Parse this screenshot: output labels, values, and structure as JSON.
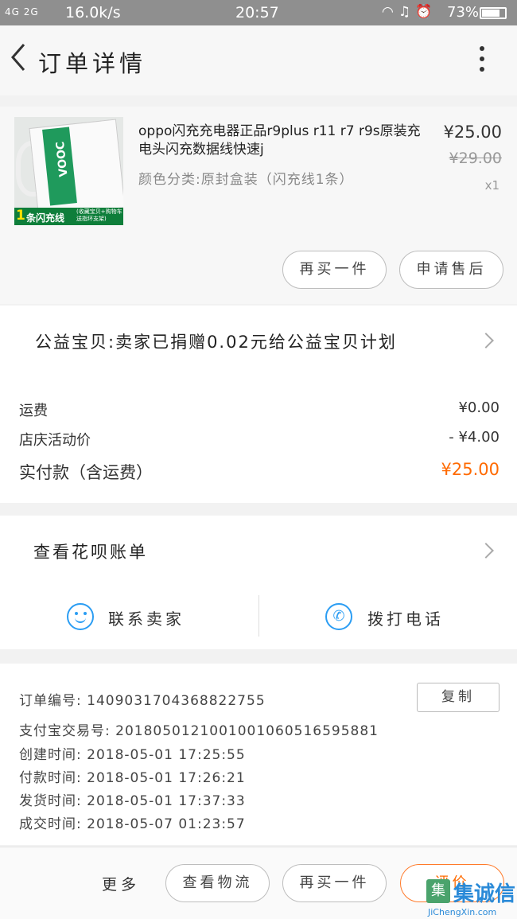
{
  "status_bar": {
    "signal": "4G 2G",
    "speed": "16.0k/s",
    "time": "20:57",
    "battery": "73%"
  },
  "header": {
    "title": "订单详情"
  },
  "product": {
    "name": "oppo闪充充电器正品r9plus r11 r7 r9s原装充电头闪充数据线快速j",
    "spec": "颜色分类:原封盒装（闪充线1条）",
    "price": "¥25.00",
    "original_price": "¥29.00",
    "quantity": "x1",
    "thumb_badge_num": "1",
    "thumb_badge_text": "条闪充线",
    "thumb_badge_small": "(收藏宝贝+购物车 送指环支架)",
    "thumb_brand": "VOOC"
  },
  "actions": {
    "buy_more": "再买一件",
    "after_sale": "申请售后"
  },
  "charity": {
    "text": "公益宝贝:卖家已捐赠0.02元给公益宝贝计划"
  },
  "fees": {
    "shipping_label": "运费",
    "shipping_value": "¥0.00",
    "promo_label": "店庆活动价",
    "promo_value": "- ¥4.00",
    "total_label": "实付款（含运费）",
    "total_value": "¥25.00"
  },
  "huabei": {
    "label": "查看花呗账单"
  },
  "contact": {
    "seller_label": "联系卖家",
    "call_label": "拨打电话"
  },
  "order_info": {
    "order_no": "订单编号:  1409031704368822755",
    "copy_label": "复制",
    "alipay_no": "支付宝交易号:  2018050121001001060516595881",
    "created": "创建时间:  2018-05-01 17:25:55",
    "paid": "付款时间:  2018-05-01 17:26:21",
    "shipped": "发货时间:  2018-05-01 17:37:33",
    "completed": "成交时间:  2018-05-07 01:23:57"
  },
  "bottom": {
    "more_label": "更多",
    "logistics": "查看物流",
    "buy_again": "再买一件",
    "review": "评价"
  },
  "watermark": {
    "logo": "集",
    "name": "集诚信",
    "url": "JiChengXin.com"
  },
  "colors": {
    "accent": "#ff6a00",
    "icon_blue": "#2b9df3"
  }
}
